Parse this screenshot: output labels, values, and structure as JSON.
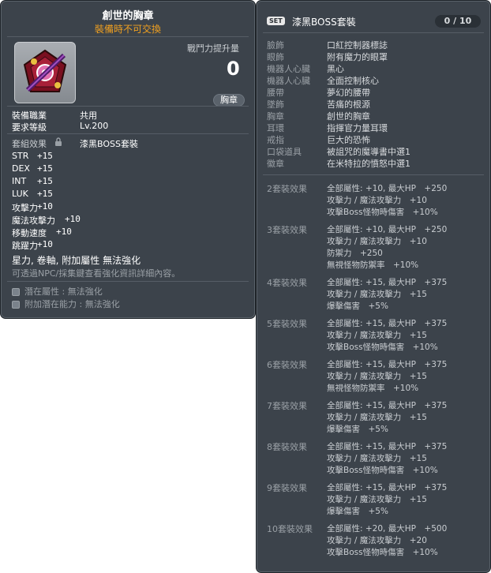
{
  "item": {
    "name": "創世的胸章",
    "trade_notice": "裝備時不可交換",
    "combat_power_label": "戰鬥力提升量",
    "combat_power_value": "0",
    "category_badge": "胸章",
    "job_label": "裝備職業",
    "job_value": "共用",
    "level_label": "要求等級",
    "level_value": "Lv.200",
    "set_label": "套組效果",
    "set_value": "漆黑BOSS套裝",
    "stats": [
      {
        "name": "STR",
        "value": "+15"
      },
      {
        "name": "DEX",
        "value": "+15"
      },
      {
        "name": "INT",
        "value": "+15"
      },
      {
        "name": "LUK",
        "value": "+15"
      },
      {
        "name": "攻擊力",
        "value": "+10"
      },
      {
        "name": "魔法攻擊力",
        "value": "+10"
      },
      {
        "name": "移動速度",
        "value": "+10"
      },
      {
        "name": "跳躍力",
        "value": "+10"
      }
    ],
    "restrictions": "星力, 卷軸, 附加屬性 無法強化",
    "npc_note": "可透過NPC/採集鍵查看強化資訊詳細內容。",
    "potential_label": "潛在屬性",
    "potential_value": "無法強化",
    "bonus_potential_label": "附加潛在能力",
    "bonus_potential_value": "無法強化"
  },
  "set_panel": {
    "tag": "SET",
    "title": "漆黑BOSS套裝",
    "count": "0 / 10",
    "pieces": [
      {
        "slot": "臉飾",
        "name": "口紅控制器標誌"
      },
      {
        "slot": "眼飾",
        "name": "附有魔力的眼罩"
      },
      {
        "slot": "機器人心臟",
        "name": "黑心"
      },
      {
        "slot": "機器人心臟",
        "name": "全面控制核心"
      },
      {
        "slot": "腰帶",
        "name": "夢幻的腰帶"
      },
      {
        "slot": "墜飾",
        "name": "苦痛的根源"
      },
      {
        "slot": "胸章",
        "name": "創世的胸章"
      },
      {
        "slot": "耳環",
        "name": "指揮官力量耳環"
      },
      {
        "slot": "戒指",
        "name": "巨大的恐怖"
      },
      {
        "slot": "口袋道具",
        "name": "被詛咒的魔導書中選1"
      },
      {
        "slot": "徽章",
        "name": "在米特拉的憤怒中選1"
      }
    ],
    "effects": [
      {
        "label": "2套裝效果",
        "lines": [
          "全部屬性: +10, 最大HP　+250",
          "攻擊力 / 魔法攻擊力　+10",
          "攻擊Boss怪物時傷害　+10%"
        ]
      },
      {
        "label": "3套裝效果",
        "lines": [
          "全部屬性: +10, 最大HP　+250",
          "攻擊力 / 魔法攻擊力　+10",
          "防禦力　+250",
          "無視怪物防禦率　+10%"
        ]
      },
      {
        "label": "4套裝效果",
        "lines": [
          "全部屬性: +15, 最大HP　+375",
          "攻擊力 / 魔法攻擊力　+15",
          "爆擊傷害　+5%"
        ]
      },
      {
        "label": "5套裝效果",
        "lines": [
          "全部屬性: +15, 最大HP　+375",
          "攻擊力 / 魔法攻擊力　+15",
          "攻擊Boss怪物時傷害　+10%"
        ]
      },
      {
        "label": "6套裝效果",
        "lines": [
          "全部屬性: +15, 最大HP　+375",
          "攻擊力 / 魔法攻擊力　+15",
          "無視怪物防禦率　+10%"
        ]
      },
      {
        "label": "7套裝效果",
        "lines": [
          "全部屬性: +15, 最大HP　+375",
          "攻擊力 / 魔法攻擊力　+15",
          "爆擊傷害　+5%"
        ]
      },
      {
        "label": "8套裝效果",
        "lines": [
          "全部屬性: +15, 最大HP　+375",
          "攻擊力 / 魔法攻擊力　+15",
          "攻擊Boss怪物時傷害　+10%"
        ]
      },
      {
        "label": "9套裝效果",
        "lines": [
          "全部屬性: +15, 最大HP　+375",
          "攻擊力 / 魔法攻擊力　+15",
          "爆擊傷害　+5%"
        ]
      },
      {
        "label": "10套裝效果",
        "lines": [
          "全部屬性: +20, 最大HP　+500",
          "攻擊力 / 魔法攻擊力　+20",
          "攻擊Boss怪物時傷害　+10%"
        ]
      }
    ]
  },
  "icons": {
    "item": "emblem-item-icon",
    "lock": "lock-icon",
    "bullet": "square-bullet-icon"
  },
  "colors": {
    "panel_bg": "#3c434b",
    "trade_notice": "#f0a020"
  }
}
